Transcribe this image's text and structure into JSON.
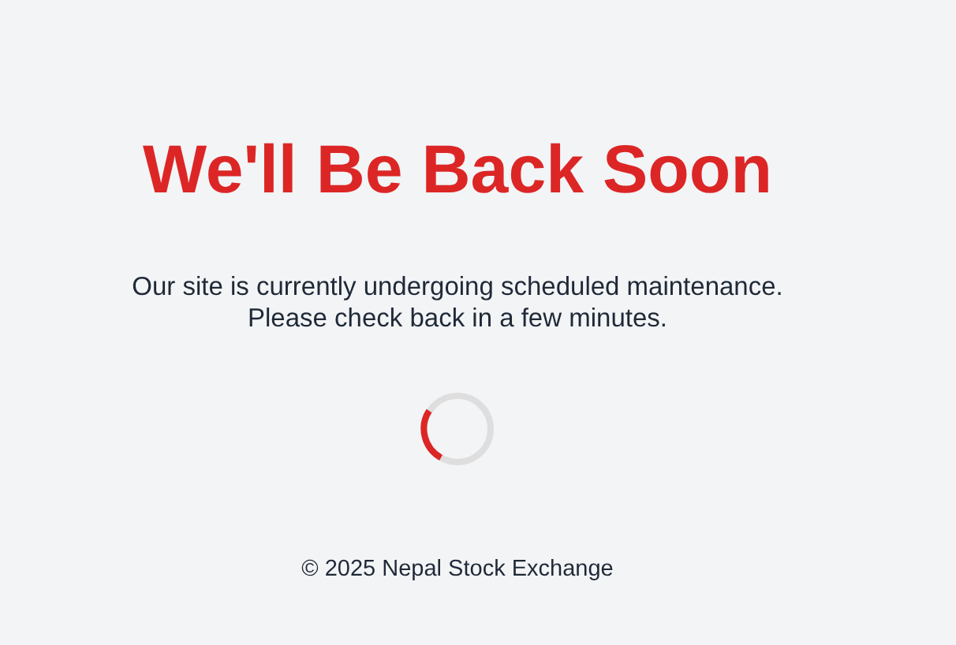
{
  "heading": "We'll Be Back Soon",
  "message": [
    "Our site is currently undergoing scheduled maintenance.",
    "Please check back in a few minutes."
  ],
  "footer": "© 2025 Nepal Stock Exchange"
}
